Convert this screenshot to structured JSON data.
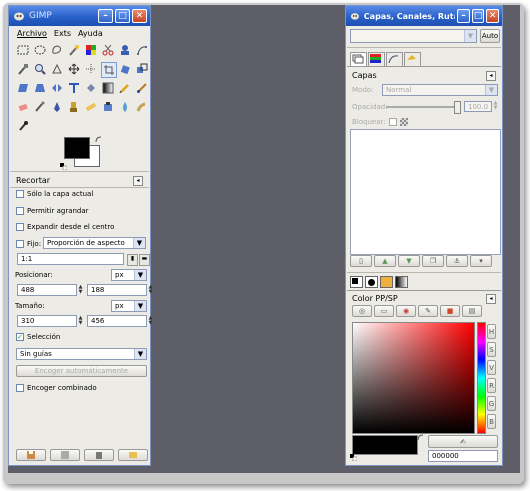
{
  "toolbox": {
    "title": "GIMP",
    "menu": [
      "Archivo",
      "Exts",
      "Ayuda"
    ],
    "tools": [
      "rect-select",
      "ellipse-select",
      "free-select",
      "fuzzy-select",
      "by-color-select",
      "scissors",
      "foreground-select",
      "paths",
      "color-picker",
      "zoom",
      "measure",
      "move",
      "align",
      "crop",
      "rotate",
      "scale",
      "shear",
      "perspective",
      "flip",
      "text",
      "bucket-fill",
      "blend",
      "pencil",
      "paintbrush",
      "eraser",
      "airbrush",
      "ink",
      "clone",
      "heal",
      "perspective-clone",
      "blur",
      "smudge",
      "dodge-burn"
    ]
  },
  "crop_options": {
    "title": "Recortar",
    "only_current_layer": "Sólo la capa actual",
    "allow_growing": "Permitir agrandar",
    "expand_from_center": "Expandir desde el centro",
    "fixed_label": "Fijo:",
    "fixed_option": "Proporción de aspecto",
    "ratio_value": "1:1",
    "position_label": "Posicionar:",
    "position_unit": "px",
    "position_x": "488",
    "position_y": "188",
    "size_label": "Tamaño:",
    "size_unit": "px",
    "size_w": "310",
    "size_h": "456",
    "selection_label": "Selección",
    "guides_option": "Sin guías",
    "auto_shrink": "Encoger automáticamente",
    "shrink_merged": "Encoger combinado"
  },
  "dock": {
    "title": "Capas, Canales, Rutas ...",
    "auto_button": "Auto",
    "layers_title": "Capas",
    "mode_label": "Modo:",
    "mode_value": "Normal",
    "opacity_label": "Opacidad:",
    "opacity_value": "100.0",
    "lock_label": "Bloquear:",
    "color_title": "Color PP/SP",
    "hex_value": "000000"
  },
  "colors": {
    "titlebar": "#2861c9",
    "workspace": "#5d5e67",
    "panel": "#ecebe6"
  }
}
